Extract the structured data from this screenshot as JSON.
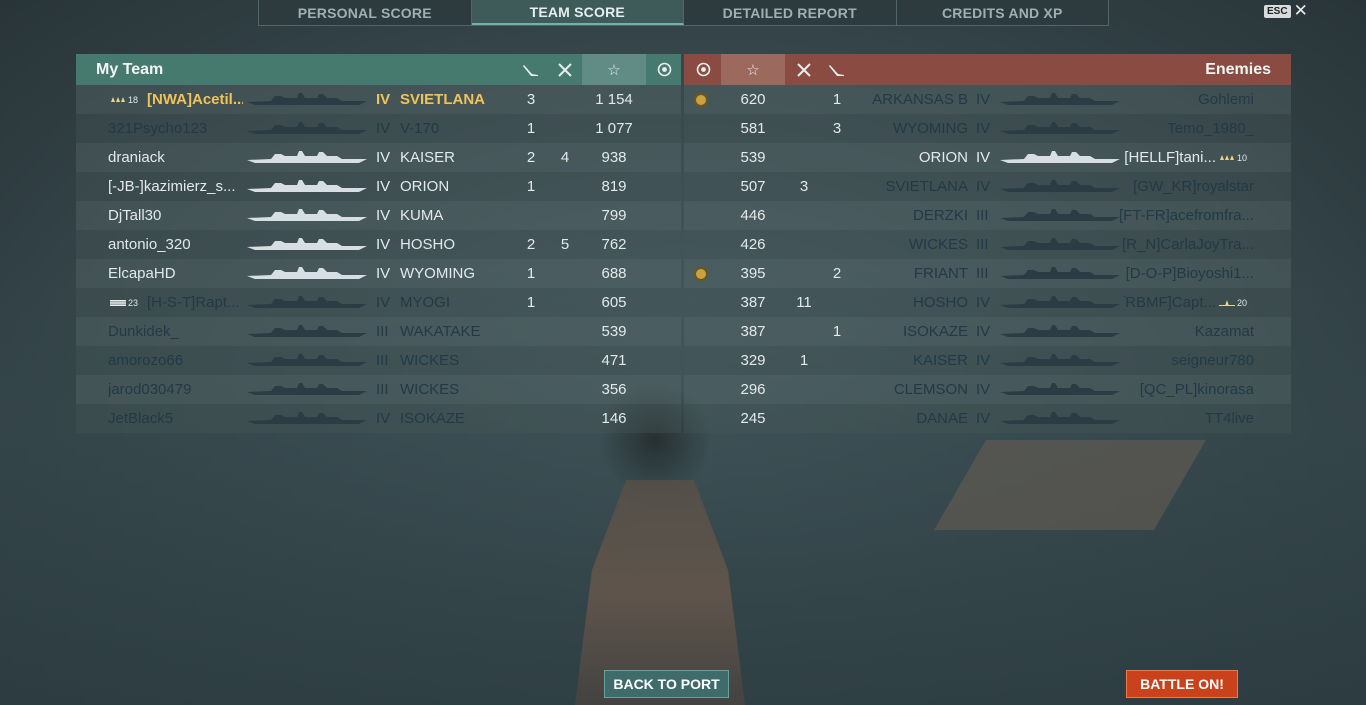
{
  "tabs": [
    "PERSONAL SCORE",
    "TEAM SCORE",
    "DETAILED REPORT",
    "CREDITS AND XP"
  ],
  "active_tab": 1,
  "esc_label": "ESC",
  "close_glyph": "✕",
  "my_team": {
    "title": "My Team",
    "col_icons": [
      "torpedo-icon",
      "planes-icon",
      "star-icon",
      "base-capture-icon"
    ],
    "rows": [
      {
        "rank": "18",
        "rank_icon": "rank-stars-icon",
        "player": "[NWA]Acetil...",
        "tier": "IV",
        "ship": "SVIETLANA",
        "c1": "3",
        "c2": "",
        "score": "1 154",
        "medal": "",
        "style": "hl"
      },
      {
        "rank": "",
        "player": "321Psycho123",
        "tier": "IV",
        "ship": "V-170",
        "c1": "1",
        "c2": "",
        "score": "1 077",
        "medal": "",
        "style": "dim"
      },
      {
        "rank": "",
        "player": "draniack",
        "tier": "IV",
        "ship": "KAISER",
        "c1": "2",
        "c2": "4",
        "score": "938",
        "medal": "",
        "style": "bright"
      },
      {
        "rank": "",
        "player": "[-JB-]kazimierz_s...",
        "tier": "IV",
        "ship": "ORION",
        "c1": "1",
        "c2": "",
        "score": "819",
        "medal": "",
        "style": "bright"
      },
      {
        "rank": "",
        "player": "DjTall30",
        "tier": "IV",
        "ship": "KUMA",
        "c1": "",
        "c2": "",
        "score": "799",
        "medal": "",
        "style": "bright"
      },
      {
        "rank": "",
        "player": "antonio_320",
        "tier": "IV",
        "ship": "HOSHO",
        "c1": "2",
        "c2": "5",
        "score": "762",
        "medal": "",
        "style": "bright"
      },
      {
        "rank": "",
        "player": "ElcapaHD",
        "tier": "IV",
        "ship": "WYOMING",
        "c1": "1",
        "c2": "",
        "score": "688",
        "medal": "",
        "style": "bright"
      },
      {
        "rank": "23",
        "rank_icon": "rank-bars-icon",
        "player": "[H-S-T]Rapt...",
        "tier": "IV",
        "ship": "MYOGI",
        "c1": "1",
        "c2": "",
        "score": "605",
        "medal": "",
        "style": "dim"
      },
      {
        "rank": "",
        "player": "Dunkidek_",
        "tier": "III",
        "ship": "WAKATAKE",
        "c1": "",
        "c2": "",
        "score": "539",
        "medal": "",
        "style": "dim"
      },
      {
        "rank": "",
        "player": "amorozo66",
        "tier": "III",
        "ship": "WICKES",
        "c1": "",
        "c2": "",
        "score": "471",
        "medal": "",
        "style": "dim"
      },
      {
        "rank": "",
        "player": "jarod030479",
        "tier": "III",
        "ship": "WICKES",
        "c1": "",
        "c2": "",
        "score": "356",
        "medal": "",
        "style": "dim"
      },
      {
        "rank": "",
        "player": "JetBlack5",
        "tier": "IV",
        "ship": "ISOKAZE",
        "c1": "",
        "c2": "",
        "score": "146",
        "medal": "",
        "style": "dim"
      }
    ]
  },
  "enemies": {
    "title": "Enemies",
    "col_icons": [
      "base-capture-icon",
      "star-icon",
      "planes-icon",
      "torpedo-icon"
    ],
    "rows": [
      {
        "medal": "yes",
        "score": "620",
        "c2": "",
        "c1": "1",
        "ship": "ARKANSAS B",
        "tier": "IV",
        "player": "Gohlemi",
        "rank": "",
        "style": "dim"
      },
      {
        "medal": "",
        "score": "581",
        "c2": "",
        "c1": "3",
        "ship": "WYOMING",
        "tier": "IV",
        "player": "Temo_1980_",
        "rank": "",
        "style": "dim"
      },
      {
        "medal": "",
        "score": "539",
        "c2": "",
        "c1": "",
        "ship": "ORION",
        "tier": "IV",
        "player": "[HELLF]tani...",
        "rank": "10",
        "rank_icon": "rank-stars-icon",
        "style": "bright"
      },
      {
        "medal": "",
        "score": "507",
        "c2": "3",
        "c1": "",
        "ship": "SVIETLANA",
        "tier": "IV",
        "player": "[GW_KR]royalstar",
        "rank": "",
        "style": "dim"
      },
      {
        "medal": "",
        "score": "446",
        "c2": "",
        "c1": "",
        "ship": "DERZKI",
        "tier": "III",
        "player": "[FT-FR]acefromfra...",
        "rank": "",
        "style": "dim"
      },
      {
        "medal": "",
        "score": "426",
        "c2": "",
        "c1": "",
        "ship": "WICKES",
        "tier": "III",
        "player": "[R_N]CarlaJoyTra...",
        "rank": "",
        "style": "dim"
      },
      {
        "medal": "yes",
        "score": "395",
        "c2": "",
        "c1": "2",
        "ship": "FRIANT",
        "tier": "III",
        "player": "[D-O-P]Bioyoshi1...",
        "rank": "",
        "style": "dim"
      },
      {
        "medal": "",
        "score": "387",
        "c2": "11",
        "c1": "",
        "ship": "HOSHO",
        "tier": "IV",
        "player": "[RBMF]Capt...",
        "rank": "20",
        "rank_icon": "rank-star-icon",
        "style": "dim"
      },
      {
        "medal": "",
        "score": "387",
        "c2": "",
        "c1": "1",
        "ship": "ISOKAZE",
        "tier": "IV",
        "player": "Kazamat",
        "rank": "",
        "style": "dim"
      },
      {
        "medal": "",
        "score": "329",
        "c2": "1",
        "c1": "",
        "ship": "KAISER",
        "tier": "IV",
        "player": "seigneur780",
        "rank": "",
        "style": "dim"
      },
      {
        "medal": "",
        "score": "296",
        "c2": "",
        "c1": "",
        "ship": "CLEMSON",
        "tier": "IV",
        "player": "[QC_PL]kinorasa",
        "rank": "",
        "style": "dim"
      },
      {
        "medal": "",
        "score": "245",
        "c2": "",
        "c1": "",
        "ship": "DANAE",
        "tier": "IV",
        "player": "TT4live",
        "rank": "",
        "style": "dim"
      }
    ]
  },
  "buttons": {
    "back": "BACK TO PORT",
    "battle": "BATTLE ON!"
  },
  "colors": {
    "my_team": "#467a6f",
    "enemies": "#8a4c42",
    "highlight": "#f0c35a",
    "battle_btn": "#c9421c"
  }
}
